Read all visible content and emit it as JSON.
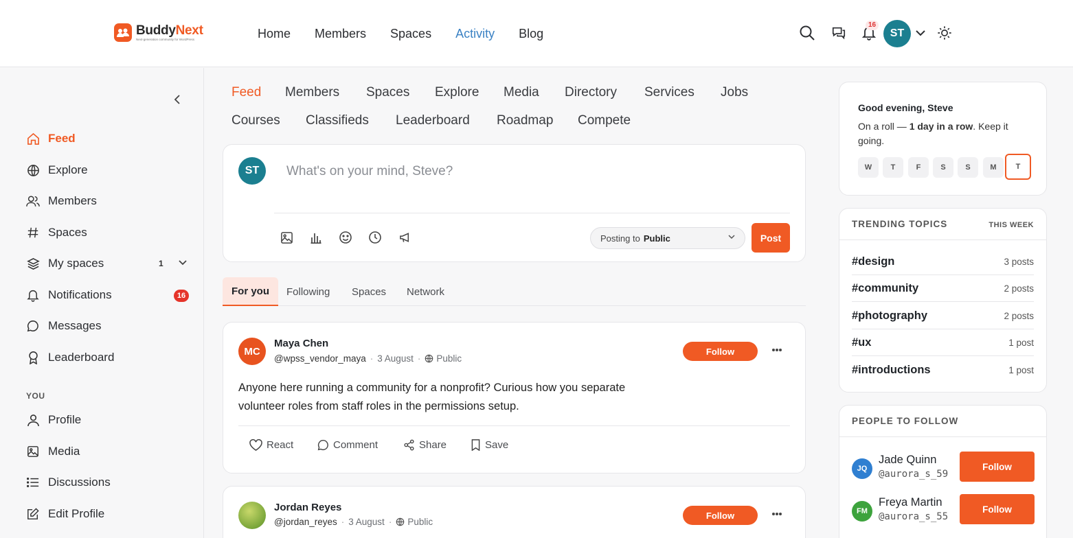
{
  "brand": {
    "name_part1": "Buddy",
    "name_part2": "Next",
    "tagline": "Next-generation community for WordPress",
    "accent": "#f05a24"
  },
  "topnav": {
    "items": [
      "Home",
      "Members",
      "Spaces",
      "Activity",
      "Blog"
    ],
    "active": "Activity",
    "notifications_count": "16",
    "user_initials": "ST"
  },
  "sidebar": {
    "items": [
      {
        "label": "Feed",
        "icon": "home-icon",
        "active": true
      },
      {
        "label": "Explore",
        "icon": "globe-icon"
      },
      {
        "label": "Members",
        "icon": "users-icon"
      },
      {
        "label": "Spaces",
        "icon": "hash-icon"
      },
      {
        "label": "My spaces",
        "icon": "layers-icon",
        "count": "1"
      },
      {
        "label": "Notifications",
        "icon": "bell-icon",
        "badge": "16"
      },
      {
        "label": "Messages",
        "icon": "message-icon"
      },
      {
        "label": "Leaderboard",
        "icon": "award-icon"
      }
    ],
    "you_heading": "YOU",
    "you_items": [
      {
        "label": "Profile",
        "icon": "user-icon"
      },
      {
        "label": "Media",
        "icon": "image-icon"
      },
      {
        "label": "Discussions",
        "icon": "list-icon"
      },
      {
        "label": "Edit Profile",
        "icon": "edit-icon"
      }
    ]
  },
  "tabs": [
    "Feed",
    "Members",
    "Spaces",
    "Explore",
    "Media",
    "Directory",
    "Services",
    "Jobs",
    "Courses",
    "Classifieds",
    "Leaderboard",
    "Roadmap",
    "Compete"
  ],
  "composer": {
    "initials": "ST",
    "placeholder": "What's on your mind, Steve?",
    "posting_to_label": "Posting to",
    "posting_to_value": "Public",
    "post_button": "Post"
  },
  "feed_tabs": [
    "For you",
    "Following",
    "Spaces",
    "Network"
  ],
  "posts": [
    {
      "initials": "MC",
      "name": "Maya Chen",
      "handle": "@wpss_vendor_maya",
      "date": "3 August",
      "visibility": "Public",
      "follow": "Follow",
      "text": "Anyone here running a community for a nonprofit? Curious how you separate volunteer roles from staff roles in the permissions setup.",
      "actions": [
        "React",
        "Comment",
        "Share",
        "Save"
      ]
    },
    {
      "initials": "",
      "name": "Jordan Reyes",
      "handle": "@jordan_reyes",
      "date": "3 August",
      "visibility": "Public",
      "follow": "Follow"
    }
  ],
  "greeting": {
    "title": "Good evening, Steve",
    "text_pre": "On a roll — ",
    "text_bold": "1 day in a row",
    "text_post": ". Keep it going.",
    "days": [
      "W",
      "T",
      "F",
      "S",
      "S",
      "M",
      "T"
    ]
  },
  "trending": {
    "title": "TRENDING TOPICS",
    "period": "THIS WEEK",
    "topics": [
      {
        "tag": "#design",
        "count": "3 posts"
      },
      {
        "tag": "#community",
        "count": "2 posts"
      },
      {
        "tag": "#photography",
        "count": "2 posts"
      },
      {
        "tag": "#ux",
        "count": "1 post"
      },
      {
        "tag": "#introductions",
        "count": "1 post"
      }
    ]
  },
  "people": {
    "title": "PEOPLE TO FOLLOW",
    "items": [
      {
        "initials": "JQ",
        "name": "Jade Quinn",
        "handle": "@aurora_s_59",
        "follow": "Follow",
        "color": "#2f7fd1"
      },
      {
        "initials": "FM",
        "name": "Freya Martin",
        "handle": "@aurora_s_55",
        "follow": "Follow",
        "color": "#3da33d"
      }
    ]
  }
}
